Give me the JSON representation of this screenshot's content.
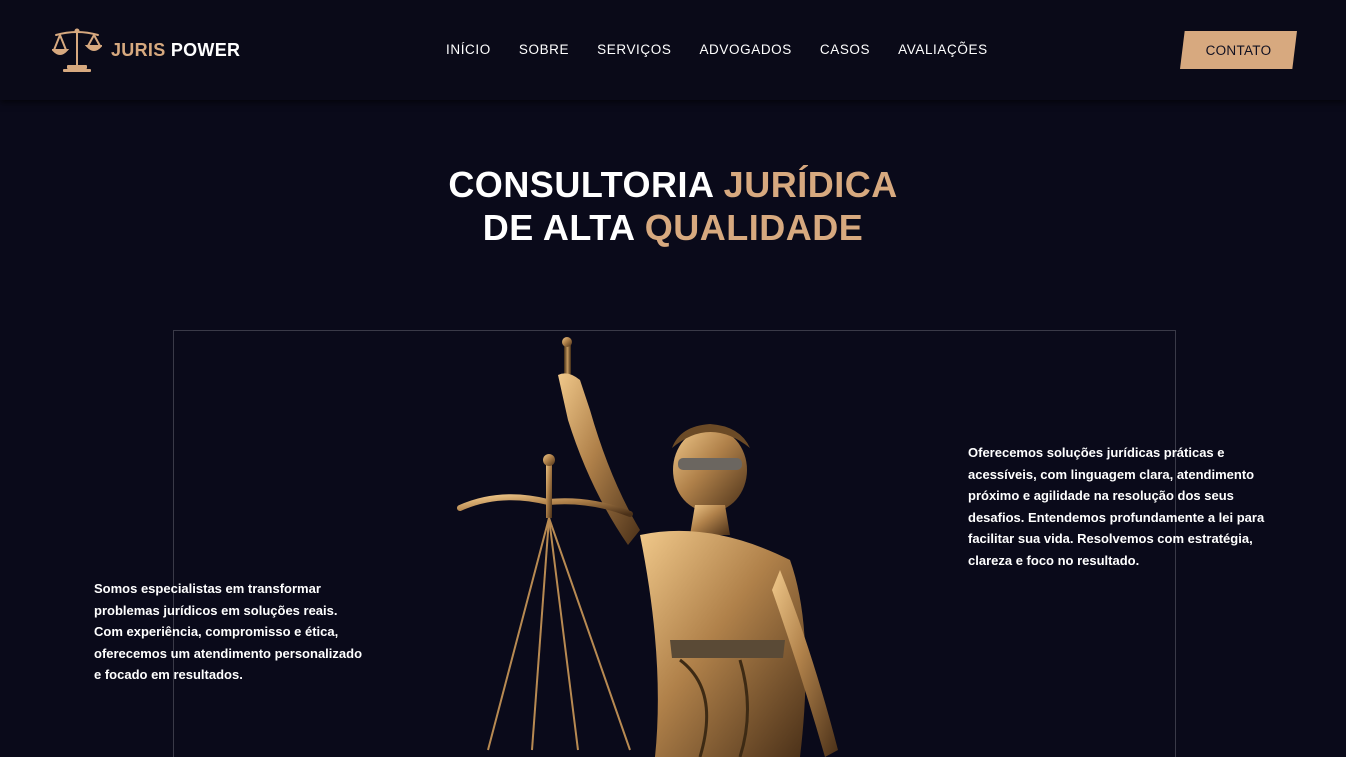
{
  "brand": {
    "name_part1": "JURIS",
    "name_part2": "POWER"
  },
  "nav": {
    "items": [
      {
        "label": "INÍCIO"
      },
      {
        "label": "SOBRE"
      },
      {
        "label": "SERVIÇOS"
      },
      {
        "label": "ADVOGADOS"
      },
      {
        "label": "CASOS"
      },
      {
        "label": "AVALIAÇÕES"
      }
    ],
    "cta_label": "CONTATO"
  },
  "hero": {
    "line1_white": "CONSULTORIA",
    "line1_gold": "JURÍDICA",
    "line2_white": "DE ALTA",
    "line2_gold": "QUALIDADE"
  },
  "about": {
    "left_text": "Somos especialistas em transformar problemas jurídicos em soluções reais. Com experiência, compromisso e ética, oferecemos um atendimento personalizado e focado em resultados.",
    "right_text": "Oferecemos soluções jurídicas práticas e acessíveis, com linguagem clara, atendimento próximo e agilidade na resolução dos seus desafios. Entendemos profundamente a lei para facilitar sua vida. Resolvemos com estratégia, clareza e foco no resultado."
  },
  "colors": {
    "background": "#0a0a1a",
    "accent": "#d7a97f",
    "text": "#ffffff"
  },
  "icons": {
    "logo": "scales-of-justice-icon",
    "hero_image": "lady-justice-statue"
  }
}
